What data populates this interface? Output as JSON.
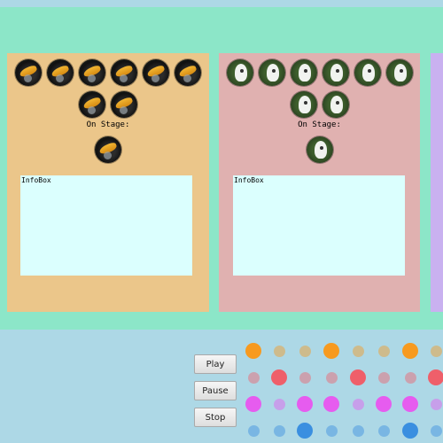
{
  "panels": [
    {
      "stage_label": "On Stage:",
      "infobox_label": "InfoBox",
      "avatar_icon": "hornbill-icon"
    },
    {
      "stage_label": "On Stage:",
      "infobox_label": "InfoBox",
      "avatar_icon": "seagull-icon"
    }
  ],
  "controls": {
    "play_label": "Play",
    "pause_label": "Pause",
    "stop_label": "Stop"
  },
  "colors": {
    "background": "#add8e6",
    "stage_area": "#8ce6c8",
    "panel_1": "#ebc68a",
    "panel_2": "#e0b1b0",
    "panel_3": "#c9b1f0",
    "infobox": "#dbfffe",
    "dots": [
      "#f79a1f",
      "#ef5f6a",
      "#e65cef",
      "#3a8fe0"
    ]
  }
}
